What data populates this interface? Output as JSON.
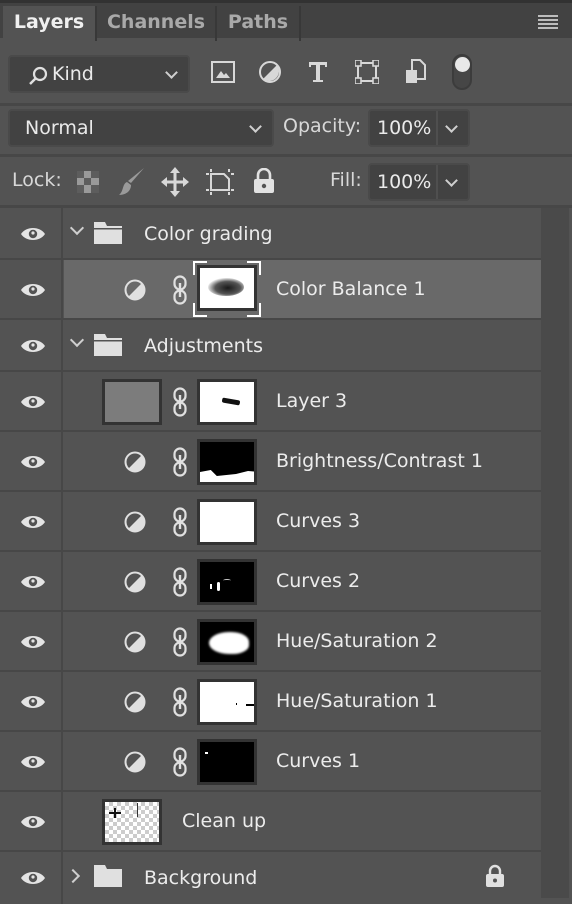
{
  "tabs": [
    {
      "label": "Layers",
      "active": true
    },
    {
      "label": "Channels",
      "active": false
    },
    {
      "label": "Paths",
      "active": false
    }
  ],
  "filter": {
    "kind_label": "Kind",
    "icons": [
      "image-filter-icon",
      "adjustment-filter-icon",
      "type-filter-icon",
      "shape-filter-icon",
      "smart-object-filter-icon",
      "filter-toggle-switch"
    ]
  },
  "blend": {
    "mode": "Normal",
    "opacity_label": "Opacity:",
    "opacity_value": "100%"
  },
  "lock": {
    "label": "Lock:",
    "fill_label": "Fill:",
    "fill_value": "100%"
  },
  "layers": [
    {
      "name": "Color grading",
      "type": "group",
      "expanded": true,
      "visible": true
    },
    {
      "name": "Color Balance 1",
      "type": "adjustment",
      "visible": true,
      "selected": true
    },
    {
      "name": "Adjustments",
      "type": "group",
      "expanded": true,
      "visible": true
    },
    {
      "name": "Layer 3",
      "type": "pixel-masked",
      "visible": true
    },
    {
      "name": "Brightness/Contrast 1",
      "type": "adjustment",
      "visible": true
    },
    {
      "name": "Curves 3",
      "type": "adjustment",
      "visible": true
    },
    {
      "name": "Curves 2",
      "type": "adjustment",
      "visible": true
    },
    {
      "name": "Hue/Saturation 2",
      "type": "adjustment",
      "visible": true
    },
    {
      "name": "Hue/Saturation 1",
      "type": "adjustment",
      "visible": true
    },
    {
      "name": "Curves 1",
      "type": "adjustment",
      "visible": true
    },
    {
      "name": "Clean up",
      "type": "pixel",
      "visible": true
    },
    {
      "name": "Background",
      "type": "group",
      "expanded": false,
      "visible": true,
      "locked": true
    }
  ],
  "colors": {
    "panel": "#535353",
    "tabbar": "#424242",
    "selected_row": "#696969"
  }
}
